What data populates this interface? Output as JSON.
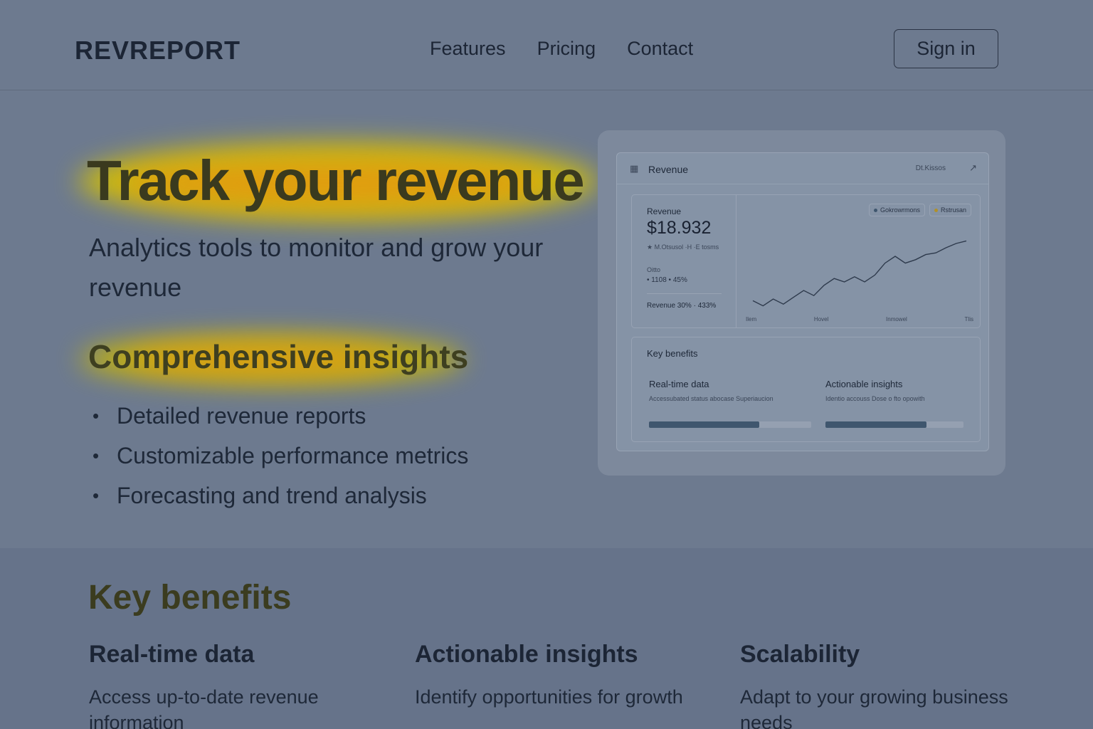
{
  "header": {
    "logo": "REVREPORT",
    "nav": [
      "Features",
      "Pricing",
      "Contact"
    ],
    "sign_in": "Sign in"
  },
  "hero": {
    "title": "Track your revenue",
    "subtitle": "Analytics tools to monitor and grow your revenue",
    "insights_title": "Comprehensive insights",
    "insights": [
      "Detailed revenue reports",
      "Customizable performance metrics",
      "Forecasting and trend analysis"
    ]
  },
  "preview": {
    "header_title": "Revenue",
    "header_option": "Dt.Kissos",
    "panel": {
      "label": "Revenue",
      "value": "$18.932",
      "sublabel": "★ M.Otsusol ·H ·E tosms",
      "mini_label": "Oitto",
      "mini_values": "• 1108  • 45%",
      "revenue_line": "Revenue 30%  · 433%",
      "legend": [
        {
          "label": "Gokrowrmons",
          "color": "#3f566e"
        },
        {
          "label": "Rstrusan",
          "color": "#b0902a"
        }
      ],
      "x_ticks": [
        "Ilem",
        "Hovel",
        "Inmowel",
        "Tlis"
      ],
      "series": [
        0.18,
        0.12,
        0.2,
        0.14,
        0.22,
        0.3,
        0.24,
        0.36,
        0.44,
        0.4,
        0.46,
        0.4,
        0.48,
        0.62,
        0.7,
        0.62,
        0.66,
        0.72,
        0.74,
        0.8,
        0.85,
        0.88
      ]
    },
    "benefits": {
      "title": "Key benefits",
      "items": [
        {
          "title": "Real-time data",
          "text": "Accessubated status abocase Superiaucion",
          "progress": 0.68
        },
        {
          "title": "Actionable insights",
          "text": "Identio accouss Dose o fto opowith",
          "progress": 0.73
        }
      ]
    }
  },
  "benefits": {
    "title": "Key benefits",
    "items": [
      {
        "title": "Real-time data",
        "text": "Access up-to-date revenue information"
      },
      {
        "title": "Actionable insights",
        "text": "Identify opportunities for growth"
      },
      {
        "title": "Scalability",
        "text": "Adapt to your growing business needs"
      }
    ]
  },
  "colors": {
    "background": "#6d7a8f",
    "heat_yellow": "#e8d000",
    "heat_orange": "#e89000"
  }
}
